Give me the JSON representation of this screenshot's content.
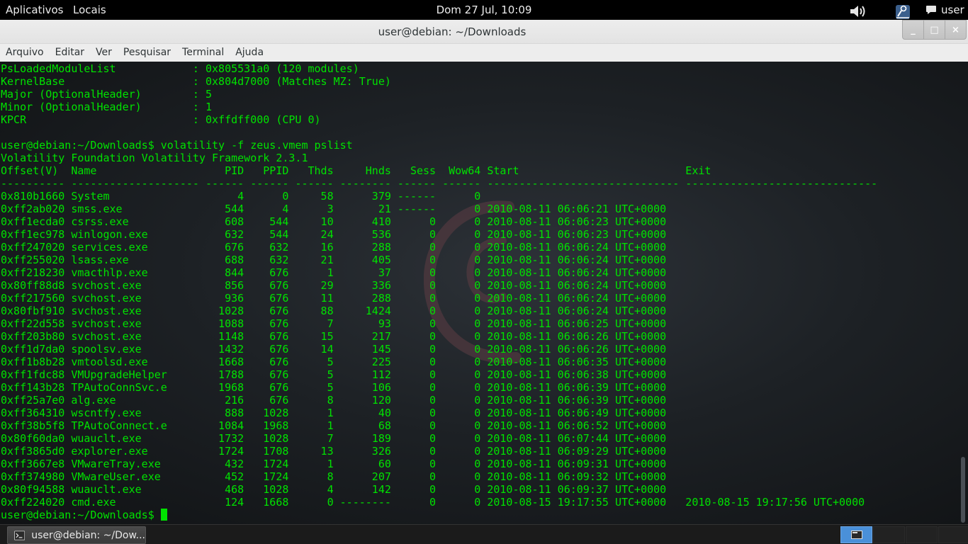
{
  "topbar": {
    "apps_label": "Aplicativos",
    "places_label": "Locais",
    "clock": "Dom 27 Jul, 10:09",
    "volume_icon": "volume-icon",
    "accessibility_icon": "accessibility-icon",
    "chat_icon": "chat-icon",
    "user_label": "user"
  },
  "window": {
    "title": "user@debian: ~/Downloads",
    "controls": {
      "minimize": "_",
      "maximize": "□",
      "close": "×"
    }
  },
  "menubar": [
    "Arquivo",
    "Editar",
    "Ver",
    "Pesquisar",
    "Terminal",
    "Ajuda"
  ],
  "terminal": {
    "lines": [
      "PsLoadedModuleList            : 0x805531a0 (120 modules)",
      "KernelBase                    : 0x804d7000 (Matches MZ: True)",
      "Major (OptionalHeader)        : 5",
      "Minor (OptionalHeader)        : 1",
      "KPCR                          : 0xffdff000 (CPU 0)",
      "",
      "user@debian:~/Downloads$ volatility -f zeus.vmem pslist",
      "Volatility Foundation Volatility Framework 2.3.1",
      "Offset(V)  Name                    PID   PPID   Thds     Hnds   Sess  Wow64 Start                          Exit",
      "---------- -------------------- ------ ------ ------ -------- ------ ------ ------------------------------ ------------------------------",
      "0x810b1660 System                    4      0     58      379 ------      0",
      "0xff2ab020 smss.exe                544      4      3       21 ------      0 2010-08-11 06:06:21 UTC+0000",
      "0xff1ecda0 csrss.exe               608    544     10      410      0      0 2010-08-11 06:06:23 UTC+0000",
      "0xff1ec978 winlogon.exe            632    544     24      536      0      0 2010-08-11 06:06:23 UTC+0000",
      "0xff247020 services.exe            676    632     16      288      0      0 2010-08-11 06:06:24 UTC+0000",
      "0xff255020 lsass.exe               688    632     21      405      0      0 2010-08-11 06:06:24 UTC+0000",
      "0xff218230 vmacthlp.exe            844    676      1       37      0      0 2010-08-11 06:06:24 UTC+0000",
      "0x80ff88d8 svchost.exe             856    676     29      336      0      0 2010-08-11 06:06:24 UTC+0000",
      "0xff217560 svchost.exe             936    676     11      288      0      0 2010-08-11 06:06:24 UTC+0000",
      "0x80fbf910 svchost.exe            1028    676     88     1424      0      0 2010-08-11 06:06:24 UTC+0000",
      "0xff22d558 svchost.exe            1088    676      7       93      0      0 2010-08-11 06:06:25 UTC+0000",
      "0xff203b80 svchost.exe            1148    676     15      217      0      0 2010-08-11 06:06:26 UTC+0000",
      "0xff1d7da0 spoolsv.exe            1432    676     14      145      0      0 2010-08-11 06:06:26 UTC+0000",
      "0xff1b8b28 vmtoolsd.exe           1668    676      5      225      0      0 2010-08-11 06:06:35 UTC+0000",
      "0xff1fdc88 VMUpgradeHelper        1788    676      5      112      0      0 2010-08-11 06:06:38 UTC+0000",
      "0xff143b28 TPAutoConnSvc.e        1968    676      5      106      0      0 2010-08-11 06:06:39 UTC+0000",
      "0xff25a7e0 alg.exe                 216    676      8      120      0      0 2010-08-11 06:06:39 UTC+0000",
      "0xff364310 wscntfy.exe             888   1028      1       40      0      0 2010-08-11 06:06:49 UTC+0000",
      "0xff38b5f8 TPAutoConnect.e        1084   1968      1       68      0      0 2010-08-11 06:06:52 UTC+0000",
      "0x80f60da0 wuauclt.exe            1732   1028      7      189      0      0 2010-08-11 06:07:44 UTC+0000",
      "0xff3865d0 explorer.exe           1724   1708     13      326      0      0 2010-08-11 06:09:29 UTC+0000",
      "0xff3667e8 VMwareTray.exe          432   1724      1       60      0      0 2010-08-11 06:09:31 UTC+0000",
      "0xff374980 VMwareUser.exe          452   1724      8      207      0      0 2010-08-11 06:09:32 UTC+0000",
      "0x80f94588 wuauclt.exe             468   1028      4      142      0      0 2010-08-11 06:09:37 UTC+0000",
      "0xff224020 cmd.exe                 124   1668      0 --------      0      0 2010-08-15 19:17:55 UTC+0000   2010-08-15 19:17:56 UTC+0000"
    ],
    "prompt": "user@debian:~/Downloads$ ",
    "logo": "debian-swirl-logo",
    "text_color": "#00e200"
  },
  "bottom_panel": {
    "task_label": "user@debian: ~/Dow...",
    "task_icon": "terminal-icon",
    "workspace_count": 4,
    "active_workspace": 1
  }
}
